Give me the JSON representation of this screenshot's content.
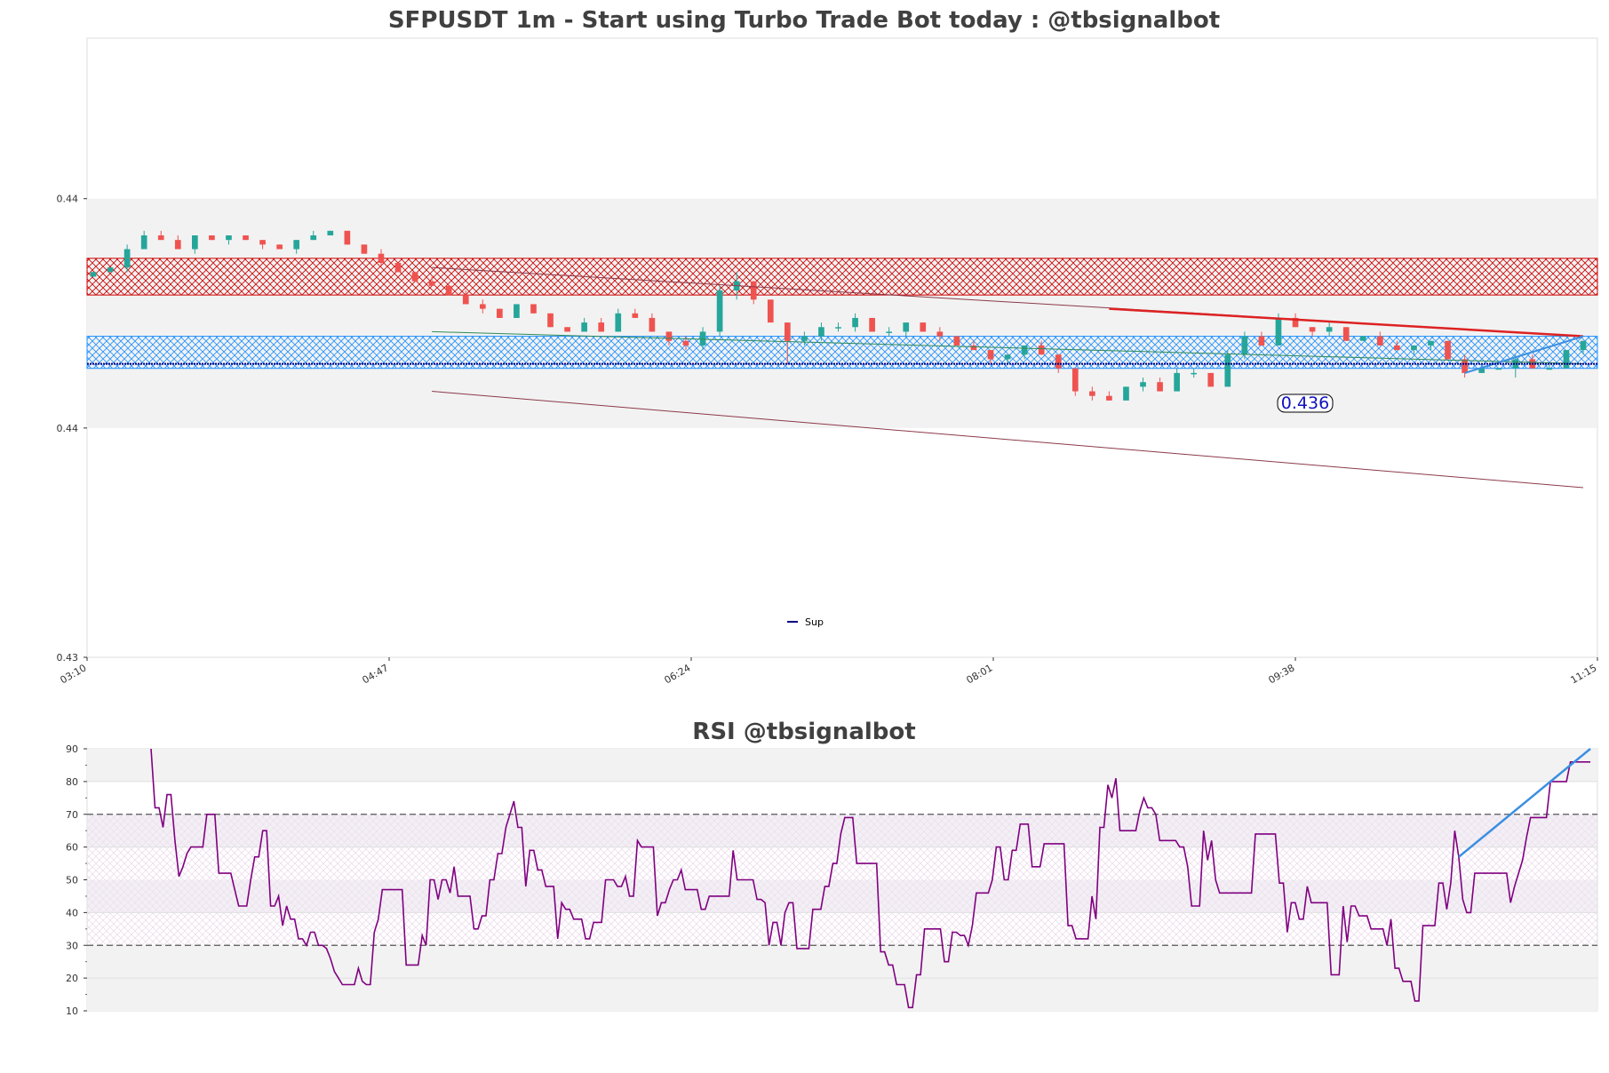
{
  "chart_data": [
    {
      "type": "candlestick",
      "title": "SFPUSDT 1m - Start using Turbo Trade Bot today : @tbsignalbot",
      "ylim": [
        0.43,
        0.4435
      ],
      "y_ticks": [
        {
          "value": 0.44,
          "label": "0.44"
        },
        {
          "value": 0.435,
          "label": "0.44"
        },
        {
          "value": 0.43,
          "label": "0.43"
        }
      ],
      "x_ticks": [
        "03:10",
        "04:47",
        "06:24",
        "08:01",
        "09:38",
        "11:15"
      ],
      "gray_band": [
        0.435,
        0.44
      ],
      "resistance_zone": [
        0.4379,
        0.4387
      ],
      "support_zone": [
        0.4363,
        0.437
      ],
      "support_level": 0.4364,
      "price_label": "0.436",
      "legend": [
        {
          "name": "Sup",
          "color": "#000080"
        }
      ],
      "colors": {
        "up": "#26a69a",
        "down": "#ef5350",
        "resistance": "#cc0000",
        "support_zone": "#1e90ff",
        "support_line": "#000080",
        "trend": "#8b3a4a",
        "green_line": "#2e8b57",
        "red_trend": "#dd2222",
        "blue_trend": "#3b8fe0"
      },
      "candles": [
        [
          0.4383,
          0.4384,
          0.4383,
          0.4384
        ],
        [
          0.4384,
          0.4385,
          0.4384,
          0.4385
        ],
        [
          0.4385,
          0.439,
          0.4384,
          0.4389
        ],
        [
          0.4389,
          0.4393,
          0.4389,
          0.4392
        ],
        [
          0.4392,
          0.4393,
          0.4391,
          0.4391
        ],
        [
          0.4391,
          0.4392,
          0.4389,
          0.4389
        ],
        [
          0.4389,
          0.4392,
          0.4388,
          0.4392
        ],
        [
          0.4392,
          0.4392,
          0.4391,
          0.4391
        ],
        [
          0.4391,
          0.4392,
          0.439,
          0.4392
        ],
        [
          0.4392,
          0.4392,
          0.4391,
          0.4391
        ],
        [
          0.4391,
          0.4391,
          0.4389,
          0.439
        ],
        [
          0.439,
          0.439,
          0.4389,
          0.4389
        ],
        [
          0.4389,
          0.4391,
          0.4388,
          0.4391
        ],
        [
          0.4391,
          0.4393,
          0.4391,
          0.4392
        ],
        [
          0.4392,
          0.4393,
          0.4392,
          0.4393
        ],
        [
          0.4393,
          0.4393,
          0.439,
          0.439
        ],
        [
          0.439,
          0.439,
          0.4388,
          0.4388
        ],
        [
          0.4388,
          0.4389,
          0.4385,
          0.4386
        ],
        [
          0.4386,
          0.4386,
          0.4384,
          0.4384
        ],
        [
          0.4384,
          0.4384,
          0.4382,
          0.4382
        ],
        [
          0.4382,
          0.4383,
          0.4381,
          0.4381
        ],
        [
          0.4381,
          0.4381,
          0.4379,
          0.4379
        ],
        [
          0.4379,
          0.438,
          0.4377,
          0.4377
        ],
        [
          0.4377,
          0.4378,
          0.4375,
          0.4376
        ],
        [
          0.4376,
          0.4376,
          0.4374,
          0.4374
        ],
        [
          0.4374,
          0.4377,
          0.4374,
          0.4377
        ],
        [
          0.4377,
          0.4377,
          0.4375,
          0.4375
        ],
        [
          0.4375,
          0.4375,
          0.4372,
          0.4372
        ],
        [
          0.4372,
          0.4372,
          0.4371,
          0.4371
        ],
        [
          0.4371,
          0.4374,
          0.4371,
          0.4373
        ],
        [
          0.4373,
          0.4374,
          0.4371,
          0.4371
        ],
        [
          0.4371,
          0.4376,
          0.4371,
          0.4375
        ],
        [
          0.4375,
          0.4376,
          0.4374,
          0.4374
        ],
        [
          0.4374,
          0.4375,
          0.4371,
          0.4371
        ],
        [
          0.4371,
          0.4371,
          0.4368,
          0.4369
        ],
        [
          0.4369,
          0.437,
          0.4367,
          0.4368
        ],
        [
          0.4368,
          0.4372,
          0.4367,
          0.4371
        ],
        [
          0.4371,
          0.4381,
          0.437,
          0.438
        ],
        [
          0.438,
          0.4384,
          0.4378,
          0.4382
        ],
        [
          0.4382,
          0.4382,
          0.4377,
          0.4378
        ],
        [
          0.4378,
          0.4378,
          0.4373,
          0.4373
        ],
        [
          0.4373,
          0.4373,
          0.4364,
          0.4369
        ],
        [
          0.4369,
          0.4371,
          0.4368,
          0.437
        ],
        [
          0.437,
          0.4373,
          0.4369,
          0.4372
        ],
        [
          0.4372,
          0.4373,
          0.4371,
          0.4372
        ],
        [
          0.4372,
          0.4375,
          0.4371,
          0.4374
        ],
        [
          0.4374,
          0.4374,
          0.4371,
          0.4371
        ],
        [
          0.4371,
          0.4372,
          0.437,
          0.4371
        ],
        [
          0.4371,
          0.4373,
          0.437,
          0.4373
        ],
        [
          0.4373,
          0.4373,
          0.4371,
          0.4371
        ],
        [
          0.4371,
          0.4372,
          0.4369,
          0.437
        ],
        [
          0.437,
          0.437,
          0.4368,
          0.4368
        ],
        [
          0.4368,
          0.4369,
          0.4367,
          0.4367
        ],
        [
          0.4367,
          0.4367,
          0.4364,
          0.4365
        ],
        [
          0.4365,
          0.4366,
          0.4364,
          0.4366
        ],
        [
          0.4366,
          0.4368,
          0.4365,
          0.4368
        ],
        [
          0.4368,
          0.4369,
          0.4366,
          0.4366
        ],
        [
          0.4366,
          0.4366,
          0.4362,
          0.4363
        ],
        [
          0.4363,
          0.4363,
          0.4357,
          0.4358
        ],
        [
          0.4358,
          0.4359,
          0.4356,
          0.4357
        ],
        [
          0.4357,
          0.4358,
          0.4356,
          0.4356
        ],
        [
          0.4356,
          0.4359,
          0.4356,
          0.4359
        ],
        [
          0.4359,
          0.4361,
          0.4358,
          0.436
        ],
        [
          0.436,
          0.4361,
          0.4358,
          0.4358
        ],
        [
          0.4358,
          0.4363,
          0.4358,
          0.4362
        ],
        [
          0.4362,
          0.4363,
          0.4361,
          0.4362
        ],
        [
          0.4362,
          0.4362,
          0.4359,
          0.4359
        ],
        [
          0.4359,
          0.4367,
          0.4359,
          0.4366
        ],
        [
          0.4366,
          0.4371,
          0.4365,
          0.437
        ],
        [
          0.437,
          0.4371,
          0.4368,
          0.4368
        ],
        [
          0.4368,
          0.4375,
          0.4368,
          0.4374
        ],
        [
          0.4374,
          0.4375,
          0.4372,
          0.4372
        ],
        [
          0.4372,
          0.4372,
          0.437,
          0.4371
        ],
        [
          0.4371,
          0.4373,
          0.437,
          0.4372
        ],
        [
          0.4372,
          0.4372,
          0.4369,
          0.4369
        ],
        [
          0.4369,
          0.437,
          0.4369,
          0.437
        ],
        [
          0.437,
          0.4371,
          0.4368,
          0.4368
        ],
        [
          0.4368,
          0.4369,
          0.4367,
          0.4367
        ],
        [
          0.4367,
          0.4368,
          0.4366,
          0.4368
        ],
        [
          0.4368,
          0.4369,
          0.4367,
          0.4369
        ],
        [
          0.4369,
          0.4369,
          0.4365,
          0.4365
        ],
        [
          0.4365,
          0.4366,
          0.4361,
          0.4362
        ],
        [
          0.4362,
          0.4363,
          0.4362,
          0.4363
        ],
        [
          0.4363,
          0.4363,
          0.4363,
          0.4363
        ],
        [
          0.4363,
          0.4366,
          0.4361,
          0.4365
        ],
        [
          0.4365,
          0.4366,
          0.4363,
          0.4363
        ],
        [
          0.4363,
          0.4364,
          0.4363,
          0.4363
        ],
        [
          0.4363,
          0.4367,
          0.4363,
          0.4367
        ],
        [
          0.4367,
          0.4369,
          0.4366,
          0.4369
        ]
      ]
    },
    {
      "type": "line",
      "title": "RSI @tbsignalbot",
      "ylim": [
        10,
        90
      ],
      "y_ticks": [
        10,
        20,
        30,
        40,
        50,
        60,
        70,
        80,
        90
      ],
      "thresholds": [
        30,
        70
      ],
      "colors": {
        "rsi": "#800080",
        "trend": "#3b8fe0"
      },
      "values": [
        90,
        72,
        72,
        66,
        76,
        76,
        62,
        51,
        54,
        58,
        60,
        60,
        60,
        60,
        70,
        70,
        70,
        52,
        52,
        52,
        52,
        47,
        42,
        42,
        42,
        50,
        57,
        57,
        65,
        65,
        42,
        42,
        45,
        36,
        42,
        38,
        38,
        32,
        32,
        30,
        34,
        34,
        30,
        30,
        29,
        26,
        22,
        20,
        18,
        18,
        18,
        18,
        23,
        19,
        18,
        18,
        34,
        38,
        47,
        47,
        47,
        47,
        47,
        47,
        24,
        24,
        24,
        24,
        33,
        30,
        50,
        50,
        44,
        50,
        50,
        46,
        54,
        45,
        45,
        45,
        45,
        35,
        35,
        39,
        39,
        50,
        50,
        58,
        58,
        66,
        70,
        74,
        66,
        66,
        48,
        59,
        59,
        53,
        53,
        48,
        48,
        48,
        32,
        43,
        41,
        41,
        38,
        38,
        38,
        32,
        32,
        37,
        37,
        37,
        50,
        50,
        50,
        48,
        48,
        51,
        45,
        45,
        62,
        60,
        60,
        60,
        60,
        39,
        43,
        43,
        47,
        50,
        50,
        53,
        47,
        47,
        47,
        47,
        41,
        41,
        45,
        45,
        45,
        45,
        45,
        45,
        59,
        50,
        50,
        50,
        50,
        50,
        44,
        44,
        43,
        30,
        37,
        37,
        30,
        40,
        43,
        43,
        29,
        29,
        29,
        29,
        41,
        41,
        41,
        48,
        48,
        55,
        55,
        64,
        69,
        69,
        69,
        55,
        55,
        55,
        55,
        55,
        55,
        28,
        28,
        24,
        24,
        18,
        18,
        18,
        11,
        11,
        21,
        21,
        35,
        35,
        35,
        35,
        35,
        25,
        25,
        34,
        34,
        33,
        33,
        30,
        36,
        46,
        46,
        46,
        46,
        50,
        60,
        60,
        50,
        50,
        59,
        59,
        67,
        67,
        67,
        54,
        54,
        54,
        61,
        61,
        61,
        61,
        61,
        61,
        36,
        36,
        32,
        32,
        32,
        32,
        45,
        38,
        66,
        66,
        79,
        75,
        81,
        65,
        65,
        65,
        65,
        65,
        71,
        75,
        72,
        72,
        70,
        62,
        62,
        62,
        62,
        62,
        60,
        60,
        54,
        42,
        42,
        42,
        65,
        56,
        62,
        50,
        46,
        46,
        46,
        46,
        46,
        46,
        46,
        46,
        46,
        64,
        64,
        64,
        64,
        64,
        64,
        49,
        49,
        34,
        43,
        43,
        38,
        38,
        48,
        43,
        43,
        43,
        43,
        43,
        21,
        21,
        21,
        42,
        31,
        42,
        42,
        39,
        39,
        39,
        35,
        35,
        35,
        35,
        30,
        38,
        23,
        23,
        19,
        19,
        19,
        13,
        13,
        36,
        36,
        36,
        36,
        49,
        49,
        41,
        49,
        65,
        57,
        44,
        40,
        40,
        52,
        52,
        52,
        52,
        52,
        52,
        52,
        52,
        52,
        43,
        48,
        52,
        56,
        63,
        69,
        69,
        69,
        69,
        69,
        80,
        80,
        80,
        80,
        80,
        86,
        86,
        86,
        86,
        86,
        86
      ]
    }
  ]
}
